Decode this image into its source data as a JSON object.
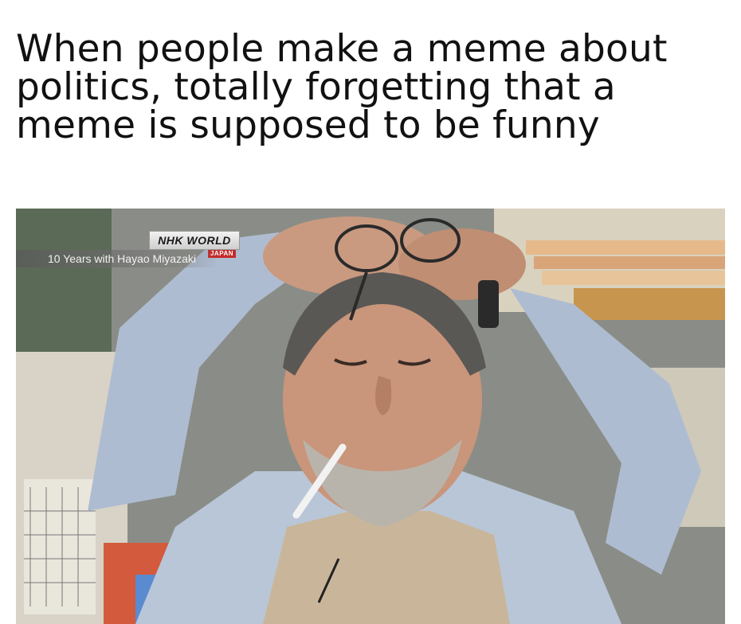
{
  "meme": {
    "caption_lines": [
      "When people make a meme about",
      "politics, totally forgetting that a",
      "meme is supposed to be funny"
    ]
  },
  "broadcast": {
    "logo_text": "NHK WORLD",
    "logo_sub": "JAPAN",
    "strip_text": "10 Years with Hayao Miyazaki"
  }
}
